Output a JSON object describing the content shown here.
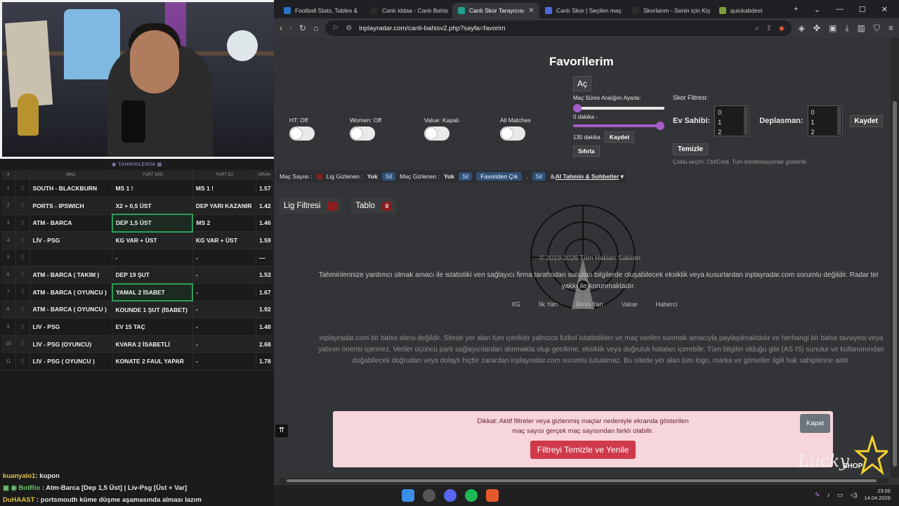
{
  "browser": {
    "tabs": [
      {
        "label": "Football Stats, Tables & ",
        "color": "#2a73c8",
        "active": false
      },
      {
        "label": "Canlı iddaa - Canlı Bahis",
        "color": "#2b2b2b",
        "active": false
      },
      {
        "label": "Canlı Skor Tarayıcısı",
        "color": "#23a08c",
        "active": true
      },
      {
        "label": "Canlı Skor | Seçilen maç",
        "color": "#4a6bd8",
        "active": false
      },
      {
        "label": "Skorlarım - Senin için Kiş",
        "color": "#2b2b2b",
        "active": false
      },
      {
        "label": "quickabdest",
        "color": "#7c9b3a",
        "active": false
      }
    ],
    "url": "inplayradar.com/canli-bahisv2.php?sayfa=favorim"
  },
  "page": {
    "title": "Favorilerim",
    "open_button": "Aç",
    "toggles": [
      {
        "label": "HT: Off"
      },
      {
        "label": "Women: Off"
      },
      {
        "label": "Value: Kapalı"
      },
      {
        "label": "All Matches"
      }
    ],
    "range": {
      "title": "Maç Süres Aralığını Ayarla:",
      "min_label": "0 dakika -",
      "max_label": "130 dakika",
      "save": "Kaydet",
      "reset": "Sıfırla"
    },
    "score_filter": {
      "title": "Skor Filtresi:",
      "home_label": "Ev Sahibi:",
      "away_label": "Deplasman:",
      "home_options": [
        "0",
        "1",
        "2"
      ],
      "away_options": [
        "0",
        "1",
        "2"
      ],
      "save": "Kaydet",
      "clear": "Temizle",
      "hint": "Çoklu seçim: Ctrl/Cmd. Tüm kombinasyonlar gösterilir."
    },
    "match_bar": {
      "count_label": "Maç Sayısı :",
      "league_hidden_label": "Lig Gizlenen :",
      "league_hidden_value": "Yok",
      "delete1": "Sil",
      "match_hidden_label": "Maç Gizlenen :",
      "match_hidden_value": "Yok",
      "delete2": "Sil",
      "fav_remove": "Favoriden Çık",
      "dot": ".",
      "delete3": "Sil",
      "ai": "AI Tahmin & Sohbetler"
    },
    "filters": [
      {
        "label": "Lig Filtresi",
        "badge": ""
      },
      {
        "label": "Tablo",
        "badge": "0"
      }
    ],
    "copyright": "© 2019-2026 Tüm Hakları Saklıdır.",
    "disclaimer1": "Tahminlerinize yardımcı olmak amacı ile istatistiki veri sağlayıcı firma tarafından sunulan bilgilerde oluşabilecek eksiklik veya kusurlardan inplayradar.com sorumlu değildir. Radar tel yakkı ile korunmaktadır.",
    "foot_nav": [
      "XG",
      "İlk Yarı",
      "İkinci Yarı",
      "Value",
      "Haberci"
    ],
    "disclaimer2": "inplayradar.com bir bahis sitesi değildir. Sitede yer alan tüm içerikler yalnızca futbol istatistikleri ve maç verileri sunmak amacıyla paylaşılmaktadır ve herhangi bir bahis tavsiyesi veya yatırım önerisi içermez. Veriler üçüncü parti sağlayıcılardan alınmakta olup gecikme, eksiklik veya doğruluk hataları içerebilir. Tüm bilgiler olduğu gibi (AS IS) sunulur ve kullanımından doğabilecek doğrudan veya dolaylı hiçbir zarardan inplayradar.com sorumlu tutulamaz. Bu sitede yer alan tüm logo, marka ve görseller ilgili hak sahiplerine aittir.",
    "alert": {
      "line1": "Dikkat: Aktif filtreler veya gizlenmiş maçlar nedeniyle ekranda gösterilen",
      "line2": "maç sayısı gerçek maç sayısından farklı olabilir.",
      "action": "Filtreyi Temizle ve Yenile",
      "close": "Kapat"
    },
    "totop": "⇈",
    "logo_text": "Lucky SHOP"
  },
  "predictions": {
    "title": "TAHMİNLERİM",
    "headers": [
      "#",
      "MAÇ",
      "YURT DIŞI",
      "YURT İÇİ",
      "ORAN"
    ],
    "rows": [
      {
        "n": "1",
        "match": "SOUTH - BLACKBURN",
        "abroad": "MS 1 !",
        "domestic": "MS 1 !",
        "odds": "1.57",
        "hl": false
      },
      {
        "n": "2",
        "match": "PORTS - IPSWICH",
        "abroad": "X2 + 0,5 ÜST",
        "domestic": "DEP YARI KAZANIR",
        "odds": "1.42",
        "hl": false
      },
      {
        "n": "3",
        "match": "ATM - BARCA",
        "abroad": "DEP 1,5 ÜST",
        "domestic": "MS 2",
        "odds": "1.46",
        "hl": true
      },
      {
        "n": "4",
        "match": "LİV - PSG",
        "abroad": "KG VAR + ÜST",
        "domestic": "KG VAR + ÜST",
        "odds": "1.59",
        "hl": false
      },
      {
        "n": "5",
        "match": "",
        "abroad": "-",
        "domestic": "-",
        "odds": "—",
        "hl": false
      },
      {
        "n": "6",
        "match": "ATM - BARCA ( TAKIM )",
        "abroad": "DEP 19 ŞUT",
        "domestic": "-",
        "odds": "1.53",
        "hl": false
      },
      {
        "n": "7",
        "match": "ATM - BARCA ( OYUNCU )",
        "abroad": "YAMAL 2 İSABET",
        "domestic": "-",
        "odds": "1.67",
        "hl": true
      },
      {
        "n": "8",
        "match": "ATM - BARCA ( OYUNCU )",
        "abroad": "KOUNDE 1 ŞUT (İSABET)",
        "domestic": "-",
        "odds": "1.92",
        "hl": false
      },
      {
        "n": "9",
        "match": "LIV - PSG",
        "abroad": "EV 15 TAÇ",
        "domestic": "-",
        "odds": "1.48",
        "hl": false
      },
      {
        "n": "10",
        "match": "LIV - PSG (OYUNCU)",
        "abroad": "KVARA 2 İSABETLİ",
        "domestic": "-",
        "odds": "2.68",
        "hl": false
      },
      {
        "n": "11",
        "match": "LIV - PSG ( OYUNCU )",
        "abroad": "KONATE 2 FAUL YAPAR",
        "domestic": "-",
        "odds": "1.78",
        "hl": false
      }
    ]
  },
  "chat": [
    {
      "user": "kuanyalo1",
      "text": ": kupon"
    },
    {
      "user": "BotRix",
      "text": ": Atm-Barca [Dep 1,5 Üst] | Liv-Psg [Üst + Var]"
    },
    {
      "user": "DuHAAST",
      "text": ": portsmouth küme düşme aşamasında alması lazım"
    }
  ],
  "taskbar": {
    "time": "23:06",
    "date": "14.04.2026"
  }
}
